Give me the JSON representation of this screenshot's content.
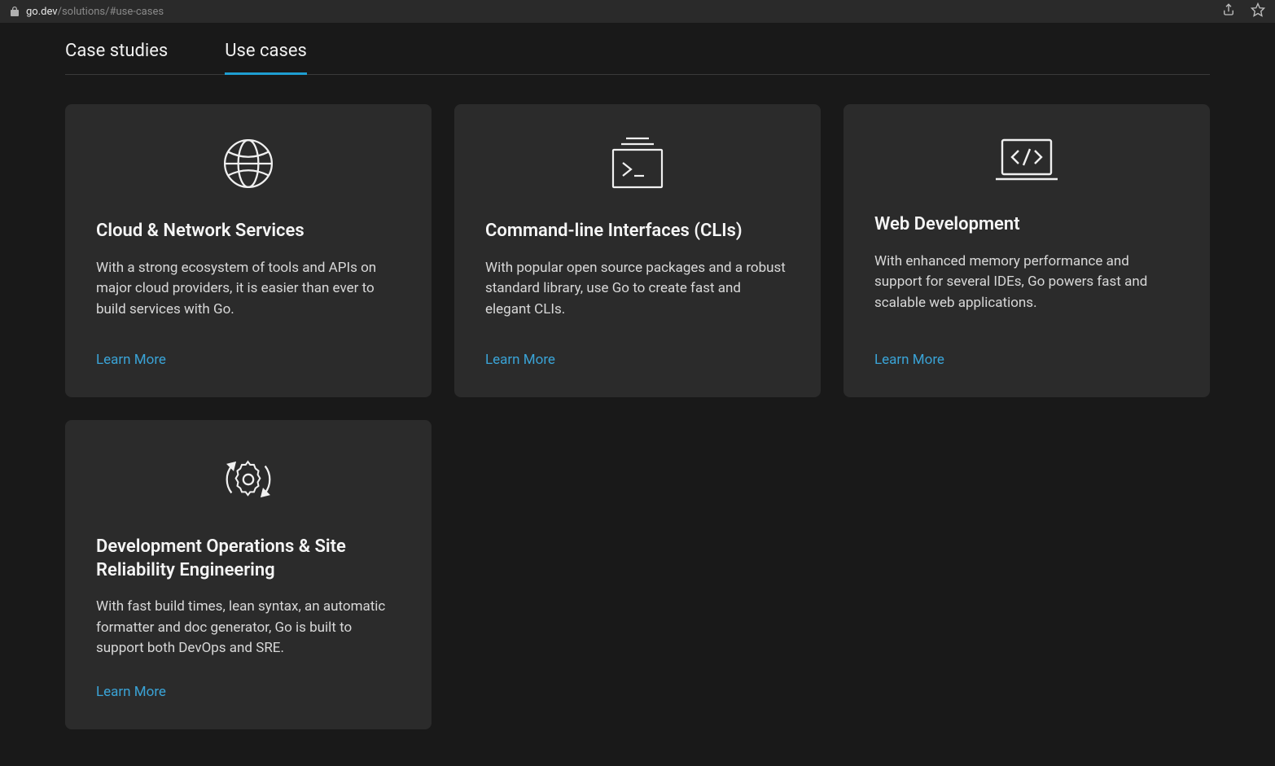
{
  "url": {
    "host": "go.dev",
    "path": "/solutions/#use-cases"
  },
  "tabs": [
    {
      "label": "Case studies",
      "active": false
    },
    {
      "label": "Use cases",
      "active": true
    }
  ],
  "cards": [
    {
      "title": "Cloud & Network Services",
      "desc": "With a strong ecosystem of tools and APIs on major cloud providers, it is easier than ever to build services with Go.",
      "link": "Learn More"
    },
    {
      "title": "Command-line Interfaces (CLIs)",
      "desc": "With popular open source packages and a robust standard library, use Go to create fast and elegant CLIs.",
      "link": "Learn More"
    },
    {
      "title": "Web Development",
      "desc": "With enhanced memory performance and support for several IDEs, Go powers fast and scalable web applications.",
      "link": "Learn More"
    },
    {
      "title": "Development Operations & Site Reliability Engineering",
      "desc": "With fast build times, lean syntax, an automatic formatter and doc generator, Go is built to support both DevOps and SRE.",
      "link": "Learn More"
    }
  ]
}
